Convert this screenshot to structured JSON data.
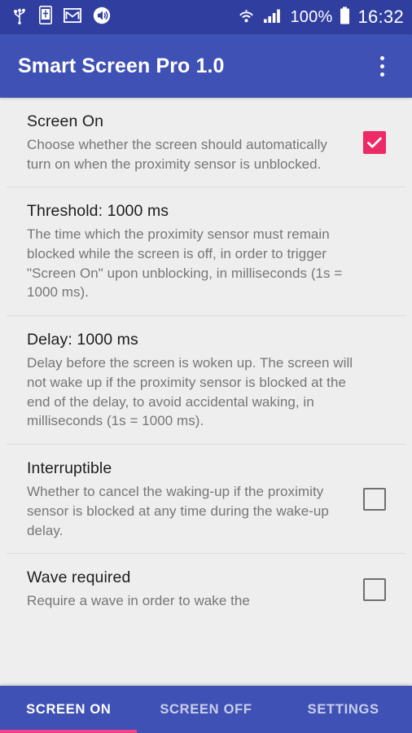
{
  "statusbar": {
    "icons": [
      "usb-icon",
      "device-icon",
      "gmail-icon",
      "volume-icon",
      "wifi-icon",
      "cellular-signal-icon",
      "battery-icon"
    ],
    "battery_percent": "100%",
    "clock": "16:32"
  },
  "appbar": {
    "title": "Smart Screen Pro 1.0",
    "overflow_label": "More options"
  },
  "colors": {
    "status_bar": "#303f9f",
    "app_bar": "#3f51b5",
    "accent_pink": "#ec2a66",
    "tab_indicator": "#f5408b",
    "background": "#eeeeee",
    "title_text": "#1d1d1d",
    "summary_text": "#767676",
    "checkbox_border": "#6f6f6f"
  },
  "preferences": [
    {
      "title": "Screen On",
      "summary": "Choose whether the screen should automatically turn on when the proximity sensor is unblocked.",
      "widget": "checkbox",
      "checked": true
    },
    {
      "title": "Threshold: 1000 ms",
      "summary": "The time which the proximity sensor must remain blocked while the screen is off, in order to trigger \"Screen On\" upon unblocking, in milliseconds (1s = 1000 ms).",
      "widget": "none",
      "checked": false
    },
    {
      "title": "Delay: 1000 ms",
      "summary": "Delay before the screen is woken up. The screen will not wake up if the proximity sensor is blocked at the end of the delay, to avoid accidental waking, in milliseconds (1s = 1000 ms).",
      "widget": "none",
      "checked": false
    },
    {
      "title": "Interruptible",
      "summary": "Whether to cancel the waking-up if the proximity sensor is blocked at any time during the wake-up delay.",
      "widget": "checkbox",
      "checked": false
    },
    {
      "title": "Wave required",
      "summary": "Require a wave in order to wake the",
      "widget": "checkbox",
      "checked": false
    }
  ],
  "tabs": [
    {
      "label": "SCREEN ON",
      "active": true
    },
    {
      "label": "SCREEN OFF",
      "active": false
    },
    {
      "label": "SETTINGS",
      "active": false
    }
  ]
}
